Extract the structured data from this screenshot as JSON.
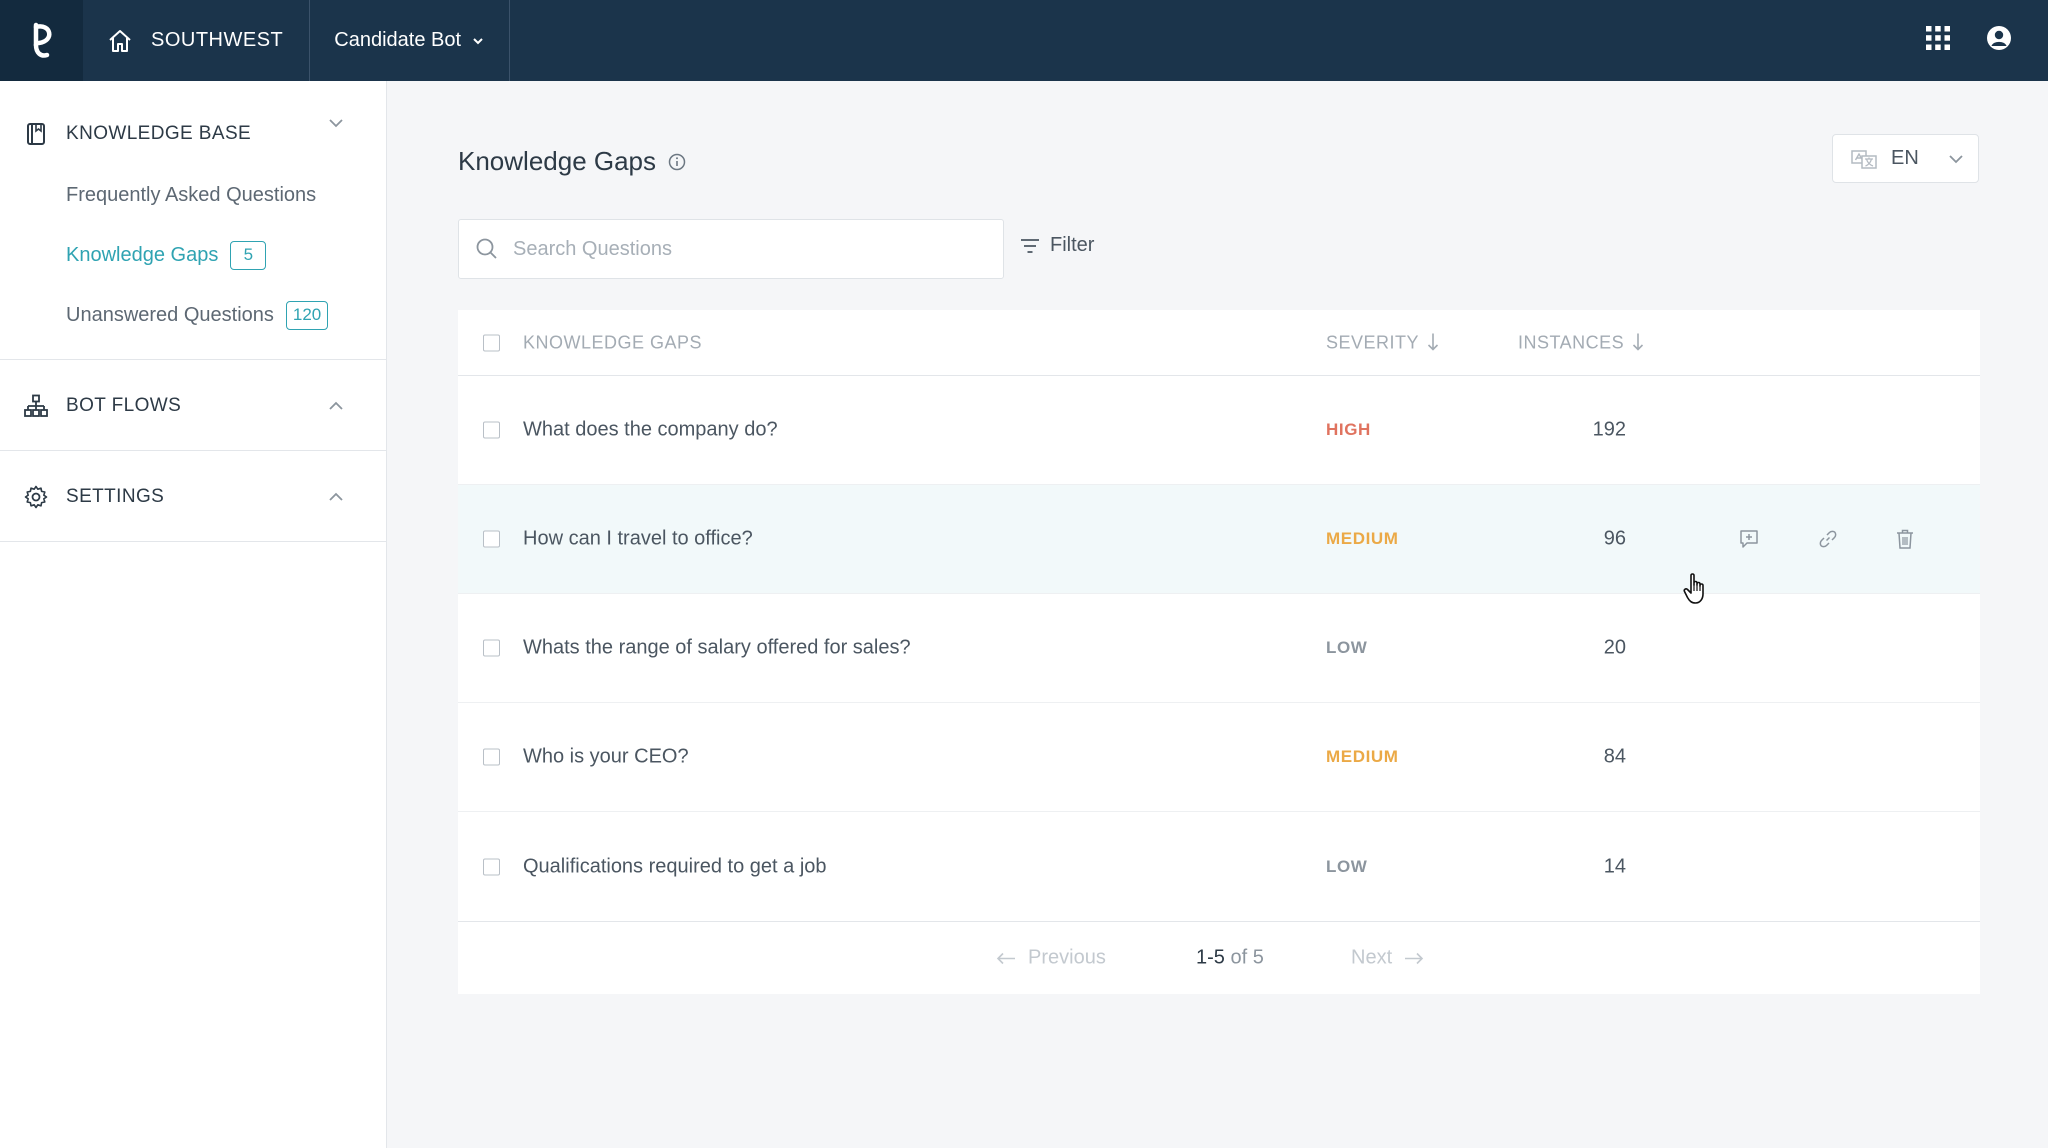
{
  "topbar": {
    "org_name": "SOUTHWEST",
    "bot_selector": "Candidate Bot"
  },
  "sidebar": {
    "knowledge_base": {
      "title": "KNOWLEDGE BASE",
      "items": [
        {
          "label": "Frequently Asked Questions",
          "badge": ""
        },
        {
          "label": "Knowledge Gaps",
          "badge": "5"
        },
        {
          "label": "Unanswered Questions",
          "badge": "120"
        }
      ]
    },
    "bot_flows": {
      "title": "BOT FLOWS"
    },
    "settings": {
      "title": "SETTINGS"
    }
  },
  "main": {
    "title": "Knowledge Gaps",
    "language": "EN",
    "search": {
      "placeholder": "Search Questions",
      "value": ""
    },
    "filter_label": "Filter",
    "table": {
      "headers": {
        "question": "KNOWLEDGE GAPS",
        "severity": "SEVERITY",
        "instances": "INSTANCES"
      },
      "rows": [
        {
          "question": "What does the company do?",
          "severity": "HIGH",
          "instances": "192"
        },
        {
          "question": "How can I travel to office?",
          "severity": "MEDIUM",
          "instances": "96"
        },
        {
          "question": "Whats the range of salary offered for sales?",
          "severity": "LOW",
          "instances": "20"
        },
        {
          "question": "Who is your CEO?",
          "severity": "MEDIUM",
          "instances": "84"
        },
        {
          "question": "Qualifications required to get a job",
          "severity": "LOW",
          "instances": "14"
        }
      ]
    },
    "pagination": {
      "previous": "Previous",
      "range": "1-5",
      "of_total": "of 5",
      "next": "Next"
    }
  },
  "colors": {
    "topbar": "#1b344b",
    "accent": "#2fa3b2",
    "high": "#e0735f",
    "medium": "#eba946",
    "low": "#8c959e"
  }
}
